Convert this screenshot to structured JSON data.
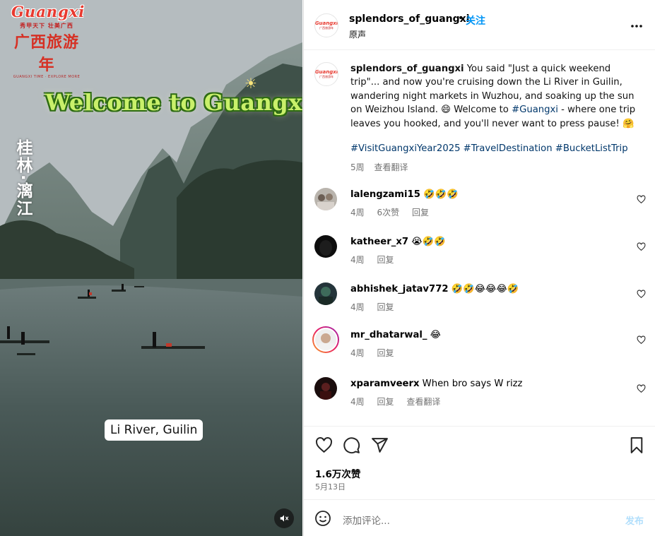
{
  "media": {
    "brand_word": "Guangxi",
    "brand_tagline": "秀甲天下 壮美广西",
    "brand_cn": "广西旅游年",
    "brand_en": "GUANGXI TIME · EXPLORE MORE",
    "welcome_text": "Welcome to Guangxi",
    "place_vertical": "桂林·漓江",
    "location_caption": "Li River, Guilin",
    "mute_icon": "speaker-muted-icon"
  },
  "header": {
    "username": "splendors_of_guangxi",
    "dot": "•",
    "follow_label": "关注",
    "subtitle": "原声",
    "more_icon": "more-horizontal-icon"
  },
  "caption": {
    "username": "splendors_of_guangxi",
    "text_part1": " You said \"Just a quick weekend trip\"... and now you're cruising down the Li River in Guilin, wandering night markets in Wuzhou, and soaking up the sun on Weizhou Island. 😄 Welcome to ",
    "hashtag_inline": "#Guangxi",
    "text_part2": " - where one trip leaves you hooked, and you'll never want to press pause! 🤗",
    "hashtags": "#VisitGuangxiYear2025 #TravelDestination #BucketListTrip",
    "time": "5周",
    "translate": "查看翻译"
  },
  "comments": [
    {
      "username": "lalengzami15",
      "text": " 🤣🤣🤣",
      "time": "4周",
      "likes": "6次赞",
      "reply": "回复",
      "translate": ""
    },
    {
      "username": "katheer_x7",
      "text": " 😭🤣🤣",
      "time": "4周",
      "likes": "",
      "reply": "回复",
      "translate": ""
    },
    {
      "username": "abhishek_jatav772",
      "text": " 🤣🤣😂😂😂🤣",
      "time": "4周",
      "likes": "",
      "reply": "回复",
      "translate": ""
    },
    {
      "username": "mr_dhatarwal_",
      "text": " 😂",
      "time": "4周",
      "likes": "",
      "reply": "回复",
      "translate": ""
    },
    {
      "username": "xparamveerx",
      "text": " When bro says W rizz",
      "time": "4周",
      "likes": "",
      "reply": "回复",
      "translate": "查看翻译"
    }
  ],
  "actions": {
    "like_icon": "heart-icon",
    "comment_icon": "comment-icon",
    "share_icon": "share-icon",
    "save_icon": "bookmark-icon",
    "likes": "1.6万次赞",
    "date": "5月13日"
  },
  "composer": {
    "placeholder": "添加评论...",
    "post_label": "发布",
    "emoji_icon": "emoji-icon"
  },
  "colors": {
    "accent": "#0095f6",
    "hashtag": "#00376b",
    "muted": "#737373",
    "post_disabled": "#b2dffc"
  }
}
